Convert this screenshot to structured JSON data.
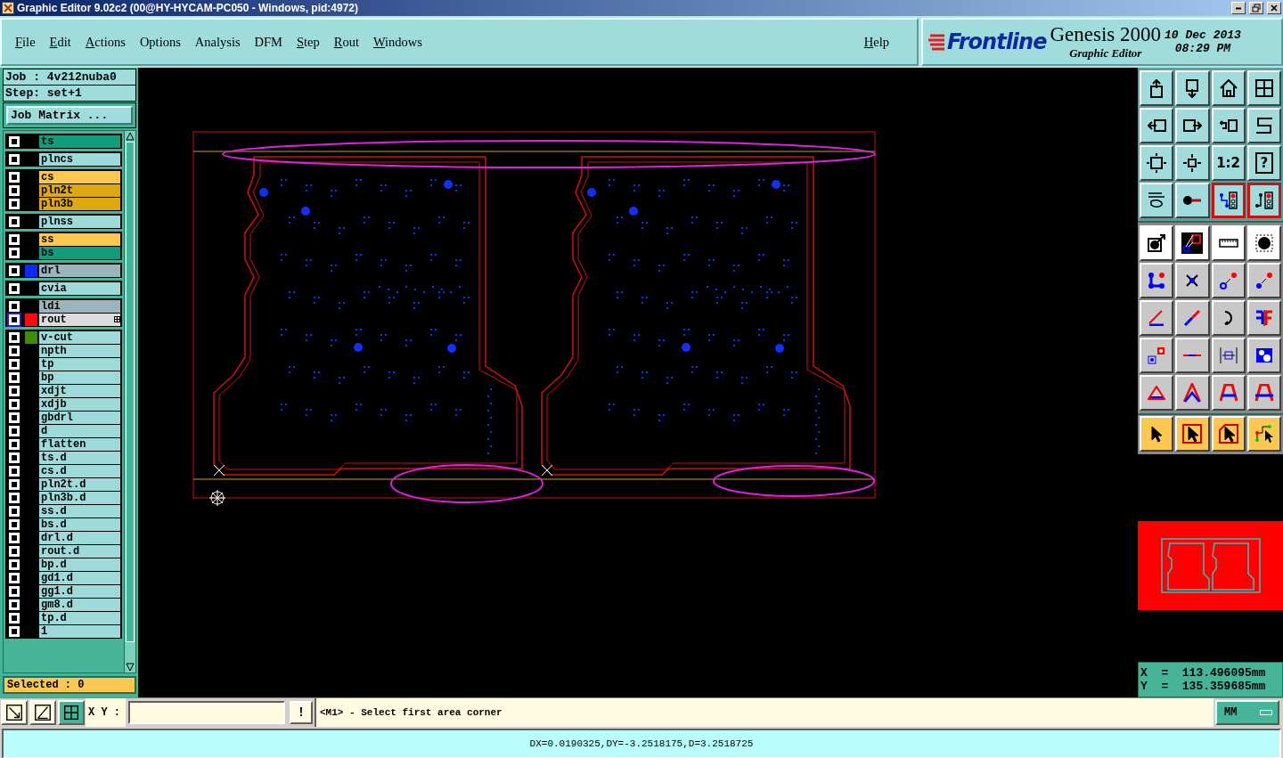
{
  "window": {
    "title": "Graphic Editor 9.02c2 (00@HY-HYCAM-PC050 - Windows, pid:4972)"
  },
  "menu": [
    {
      "label": "File",
      "underlined": true
    },
    {
      "label": "Edit",
      "underlined": true
    },
    {
      "label": "Actions",
      "underlined": true
    },
    {
      "label": "Options",
      "underlined": false
    },
    {
      "label": "Analysis",
      "underlined": false
    },
    {
      "label": "DFM",
      "underlined": false
    },
    {
      "label": "Step",
      "underlined": true
    },
    {
      "label": "Rout",
      "underlined": true
    },
    {
      "label": "Windows",
      "underlined": true
    }
  ],
  "help": "Help",
  "brand": {
    "logo": "Frontline",
    "product": "Genesis 2000",
    "subtitle": "Graphic Editor",
    "date": "10 Dec 2013",
    "time": "08:29 PM"
  },
  "job": {
    "job": "Job : 4v212nuba0",
    "step": "Step: set+1",
    "matrix_button": "Job Matrix ..."
  },
  "layer_groups": [
    {
      "layers": [
        {
          "name": "ts",
          "kind": "mask",
          "checked": true,
          "work": false
        }
      ]
    },
    {
      "layers": [
        {
          "name": "plncs",
          "kind": "misc",
          "checked": true,
          "work": false
        }
      ]
    },
    {
      "layers": [
        {
          "name": "cs",
          "kind": "signal",
          "checked": true,
          "work": false
        },
        {
          "name": "pln2t",
          "kind": "plane",
          "checked": true,
          "work": false
        },
        {
          "name": "pln3b",
          "kind": "plane",
          "checked": true,
          "work": false
        }
      ]
    },
    {
      "layers": [
        {
          "name": "plnss",
          "kind": "misc",
          "checked": true,
          "work": false
        }
      ]
    },
    {
      "layers": [
        {
          "name": "ss",
          "kind": "signal",
          "checked": true,
          "work": false
        },
        {
          "name": "bs",
          "kind": "mask",
          "checked": true,
          "work": false
        }
      ]
    },
    {
      "layers": [
        {
          "name": "drl",
          "kind": "drill",
          "color": "#0a28ff",
          "checked": true,
          "work": false
        }
      ]
    },
    {
      "layers": [
        {
          "name": "cvia",
          "kind": "misc",
          "checked": true,
          "work": false
        }
      ]
    },
    {
      "layers": [
        {
          "name": "ldi",
          "kind": "drill",
          "checked": true,
          "work": false
        },
        {
          "name": "rout",
          "kind": "rout",
          "color": "#ff0a0a",
          "checked": true,
          "work": true
        }
      ]
    },
    {
      "layers": [
        {
          "name": "v-cut",
          "kind": "misc",
          "color": "#3c8c0a",
          "checked": true,
          "work": false
        },
        {
          "name": "npth",
          "kind": "misc",
          "checked": true,
          "work": false
        },
        {
          "name": "tp",
          "kind": "misc",
          "checked": true,
          "work": false
        },
        {
          "name": "bp",
          "kind": "misc",
          "checked": true,
          "work": false
        },
        {
          "name": "xdjt",
          "kind": "misc",
          "checked": true,
          "work": false
        },
        {
          "name": "xdjb",
          "kind": "misc",
          "checked": true,
          "work": false
        },
        {
          "name": "gbdrl",
          "kind": "misc",
          "checked": true,
          "work": false
        },
        {
          "name": "d",
          "kind": "misc",
          "checked": true,
          "work": false
        },
        {
          "name": "flatten",
          "kind": "misc",
          "checked": true,
          "work": false
        },
        {
          "name": "ts.d",
          "kind": "misc",
          "checked": true,
          "work": false
        },
        {
          "name": "cs.d",
          "kind": "misc",
          "checked": true,
          "work": false
        },
        {
          "name": "pln2t.d",
          "kind": "misc",
          "checked": true,
          "work": false
        },
        {
          "name": "pln3b.d",
          "kind": "misc",
          "checked": true,
          "work": false
        },
        {
          "name": "ss.d",
          "kind": "misc",
          "checked": true,
          "work": false
        },
        {
          "name": "bs.d",
          "kind": "misc",
          "checked": true,
          "work": false
        },
        {
          "name": "drl.d",
          "kind": "misc",
          "checked": true,
          "work": false
        },
        {
          "name": "rout.d",
          "kind": "misc",
          "checked": true,
          "work": false
        },
        {
          "name": "bp.d",
          "kind": "misc",
          "checked": true,
          "work": false
        },
        {
          "name": "gd1.d",
          "kind": "misc",
          "checked": true,
          "work": false
        },
        {
          "name": "gg1.d",
          "kind": "misc",
          "checked": true,
          "work": false
        },
        {
          "name": "gm8.d",
          "kind": "misc",
          "checked": true,
          "work": false
        },
        {
          "name": "tp.d",
          "kind": "misc",
          "checked": true,
          "work": false
        },
        {
          "name": "1",
          "kind": "misc",
          "checked": true,
          "work": false
        }
      ]
    }
  ],
  "selected_count": "Selected : 0",
  "toolbox": [
    {
      "kind": "view",
      "buttons": [
        {
          "on": false
        },
        {
          "on": false
        },
        {
          "on": false
        },
        {
          "on": false
        },
        {
          "on": false
        },
        {
          "on": false
        },
        {
          "on": false
        },
        {
          "on": false
        },
        {
          "on": false
        },
        {
          "on": false
        },
        {
          "label": "1:2",
          "on": false
        },
        {
          "label": "?",
          "on": false
        },
        {
          "on": false
        },
        {
          "on": false
        },
        {
          "on": true
        },
        {
          "on": true
        }
      ]
    },
    {
      "kind": "edit",
      "buttons": [
        {
          "on": false
        },
        {
          "on": false
        },
        {
          "on": false
        },
        {
          "on": false
        },
        {
          "on": false
        },
        {
          "on": false
        },
        {
          "on": false
        },
        {
          "on": false
        },
        {
          "on": false
        },
        {
          "on": false
        },
        {
          "on": false
        },
        {
          "on": false
        },
        {
          "on": false
        },
        {
          "on": false
        },
        {
          "on": false
        },
        {
          "on": false
        },
        {
          "on": false
        },
        {
          "on": false
        },
        {
          "on": false
        },
        {
          "on": false
        }
      ]
    },
    {
      "kind": "select",
      "buttons": [
        {
          "on": false
        },
        {
          "on": false
        },
        {
          "on": false
        },
        {
          "on": false
        }
      ]
    }
  ],
  "coordinates": {
    "x": "X  =  113.496095mm",
    "y": "Y  =  135.359685mm"
  },
  "command_bar": {
    "tools": [
      {
        "selected": false
      },
      {
        "selected": false
      },
      {
        "selected": true
      }
    ],
    "xy_label": "X Y :",
    "alert": "!",
    "prompt": "<M1> - Select first area corner",
    "units": "MM"
  },
  "status_bar": "DX=0.0190325,DY=-3.2518175,D=3.2518725"
}
